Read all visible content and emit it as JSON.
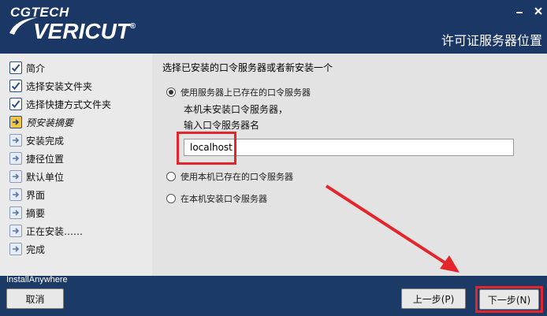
{
  "header": {
    "logo_top": "CGTECH",
    "logo_main": "VERICUT",
    "logo_mark": "®",
    "title": "许可证服务器位置"
  },
  "steps": [
    {
      "label": "简介",
      "state": "done"
    },
    {
      "label": "选择安装文件夹",
      "state": "done"
    },
    {
      "label": "选择快捷方式文件夹",
      "state": "done"
    },
    {
      "label": "预安装摘要",
      "state": "active"
    },
    {
      "label": "安装完成",
      "state": "pending"
    },
    {
      "label": "捷径位置",
      "state": "pending"
    },
    {
      "label": "默认单位",
      "state": "pending"
    },
    {
      "label": "界面",
      "state": "pending"
    },
    {
      "label": "摘要",
      "state": "pending"
    },
    {
      "label": "正在安装……",
      "state": "pending"
    },
    {
      "label": "完成",
      "state": "pending"
    }
  ],
  "main": {
    "title": "选择已安装的口令服务器或者新安装一个",
    "option_existing_server": "使用服务器上已存在的口令服务器",
    "hint_line1": "本机未安装口令服务器，",
    "hint_line2": "输入口令服务器名",
    "server_name_value": "localhost",
    "option_local_existing": "使用本机已存在的口令服务器",
    "option_install_local": "在本机安装口令服务器",
    "selected_option": "option_existing_server"
  },
  "footer": {
    "brand": "InstallAnywhere",
    "cancel_label": "取消",
    "prev_label": "上一步(P)",
    "next_label": "下一步(N)"
  },
  "colors": {
    "header_bg": "#1b3765",
    "highlight": "#e4262c"
  }
}
